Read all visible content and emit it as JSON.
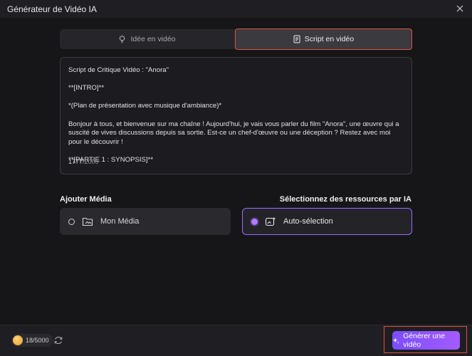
{
  "window": {
    "title": "Générateur de Vidéo IA"
  },
  "tabs": [
    {
      "label": "Idée en vidéo",
      "icon": "lightbulb-icon",
      "active": false
    },
    {
      "label": "Script en vidéo",
      "icon": "script-icon",
      "active": true
    }
  ],
  "editor": {
    "text": "Script de Critique Vidéo : \"Anora\"\n\n**[INTRO]**\n\n*(Plan de présentation avec musique d'ambiance)*\n\nBonjour à tous, et bienvenue sur ma chaîne ! Aujourd'hui, je vais vous parler du film \"Anora\", une œuvre qui a suscité de vives discussions depuis sa sortie. Est-ce un chef-d'œuvre ou une déception ? Restez avec moi pour le découvrir !\n\n**[PARTIE 1 : SYNOPSIS]**",
    "count": "1777",
    "max": "/2000"
  },
  "media": {
    "add_label": "Ajouter Média",
    "ai_label": "Sélectionnez des ressources par IA",
    "option_media": "Mon Média",
    "option_auto": "Auto-sélection",
    "selected": "auto"
  },
  "footer": {
    "credits_current": "18",
    "credits_max": "/5000",
    "generate_label": "Générer une vidéo"
  },
  "colors": {
    "accent": "#9b6cff",
    "highlight": "#e0523f"
  }
}
